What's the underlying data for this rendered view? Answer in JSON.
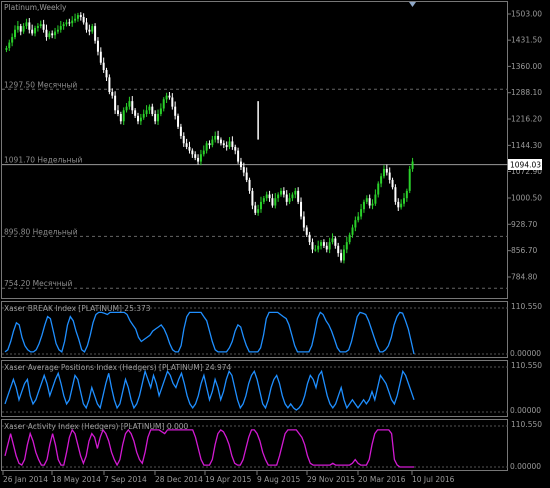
{
  "chart_title": "Platinum,Weekly",
  "price_axis": [
    "1503.00",
    "1431.50",
    "1360.00",
    "1288.10",
    "1216.20",
    "1144.30",
    "1072.90",
    "1000.50",
    "928.70",
    "856.70",
    "784.80"
  ],
  "current_price": "1094.03",
  "levels": [
    {
      "price": 1297.5,
      "label": "1297.50",
      "name": "Месячный",
      "style": "dash"
    },
    {
      "price": 1091.7,
      "label": "1091.70",
      "name": "Недельный",
      "style": "solid"
    },
    {
      "price": 895.8,
      "label": "895.80",
      "name": "Недельный",
      "style": "dash"
    },
    {
      "price": 754.2,
      "label": "754.20",
      "name": "Месячный",
      "style": "dash"
    }
  ],
  "indicators": [
    {
      "title": "Xaser BREAK Index [PLATINUM] 25.373",
      "top": "110.550",
      "bottom": "0.00000",
      "color": "#1f8fff"
    },
    {
      "title": "Xaser Average Positions Index (Hedgers) [PLATINUM] 24.974",
      "top": "110.550",
      "bottom": "0.00000",
      "color": "#1f8fff"
    },
    {
      "title": "Xaser Activity Index (Hedgers) [PLATINUM] 0.000",
      "top": "110.550",
      "bottom": "0.00000",
      "color": "#d21ad2"
    }
  ],
  "time_axis": [
    "26 Jan 2014",
    "18 May 2014",
    "7 Sep 2014",
    "28 Dec 2014",
    "19 Apr 2015",
    "9 Aug 2015",
    "29 Nov 2015",
    "20 Mar 2016",
    "10 Jul 2016"
  ],
  "colors": {
    "bull": "#2ad12a",
    "bear": "#ffffff",
    "grid": "#3a3a3a",
    "text": "#8c8c8c",
    "axis": "#9a9a9a"
  },
  "chart_data": [
    {
      "type": "candlestick",
      "title": "Platinum,Weekly",
      "ylim": [
        748,
        1530
      ],
      "series": [
        {
          "values": [
            1410,
            1425,
            1440,
            1460,
            1470,
            1455,
            1470,
            1480,
            1460,
            1450,
            1465,
            1470,
            1475,
            1460,
            1440,
            1450,
            1445,
            1455,
            1460,
            1470,
            1475,
            1480,
            1478,
            1485,
            1490,
            1500,
            1495,
            1480,
            1460,
            1455,
            1470,
            1430,
            1400,
            1370,
            1350,
            1330,
            1290,
            1280,
            1240,
            1230,
            1210,
            1240,
            1250,
            1265,
            1240,
            1225,
            1210,
            1220,
            1230,
            1240,
            1250,
            1230,
            1210,
            1230,
            1245,
            1270,
            1280,
            1275,
            1250,
            1225,
            1195,
            1170,
            1150,
            1140,
            1130,
            1120,
            1110,
            1100,
            1120,
            1130,
            1150,
            1145,
            1160,
            1170,
            1160,
            1150,
            1145,
            1140,
            1155,
            1140,
            1130,
            1100,
            1085,
            1070,
            1050,
            1020,
            980,
            960,
            970,
            990,
            1000,
            1010,
            1000,
            980,
            1000,
            1010,
            1020,
            1010,
            990,
            1000,
            1010,
            1020,
            990,
            950,
            920,
            900,
            880,
            860,
            860,
            870,
            880,
            870,
            860,
            880,
            890,
            870,
            850,
            830,
            860,
            880,
            900,
            920,
            940,
            950,
            970,
            990,
            1000,
            980,
            985,
            1010,
            1040,
            1060,
            1080,
            1070,
            1050,
            1030,
            990,
            975,
            985,
            1000,
            1020,
            1080,
            1100
          ]
        }
      ],
      "levels": [
        1297.5,
        1091.7,
        895.8,
        754.2
      ]
    },
    {
      "type": "line",
      "title": "Xaser BREAK Index [PLATINUM] 25.373",
      "ylim": [
        0,
        110.55
      ],
      "series": [
        {
          "values": [
            5,
            10,
            30,
            55,
            75,
            70,
            40,
            20,
            10,
            5,
            5,
            10,
            25,
            45,
            70,
            90,
            85,
            55,
            25,
            10,
            5,
            30,
            70,
            90,
            80,
            55,
            35,
            10,
            5,
            20,
            45,
            75,
            95,
            100,
            100,
            98,
            95,
            100,
            100,
            100,
            100,
            100,
            100,
            95,
            80,
            70,
            60,
            40,
            30,
            35,
            40,
            45,
            55,
            60,
            65,
            70,
            60,
            45,
            25,
            10,
            5,
            5,
            20,
            60,
            90,
            100,
            100,
            100,
            100,
            100,
            90,
            80,
            55,
            30,
            10,
            5,
            5,
            5,
            5,
            15,
            30,
            55,
            70,
            65,
            40,
            20,
            5,
            5,
            5,
            5,
            15,
            45,
            85,
            100,
            100,
            100,
            100,
            95,
            90,
            85,
            70,
            45,
            20,
            5,
            5,
            5,
            5,
            5,
            20,
            50,
            85,
            100,
            95,
            80,
            70,
            55,
            35,
            15,
            5,
            5,
            5,
            10,
            30,
            60,
            90,
            100,
            98,
            95,
            80,
            60,
            40,
            20,
            5,
            5,
            10,
            20,
            40,
            70,
            90,
            100,
            98,
            80,
            60,
            30,
            0
          ]
        }
      ]
    },
    {
      "type": "line",
      "title": "Xaser Average Positions Index (Hedgers) [PLATINUM] 24.974",
      "ylim": [
        0,
        110.55
      ],
      "series": [
        {
          "values": [
            20,
            40,
            60,
            80,
            60,
            30,
            50,
            70,
            80,
            40,
            20,
            30,
            50,
            70,
            90,
            70,
            40,
            60,
            80,
            95,
            70,
            40,
            20,
            30,
            60,
            90,
            80,
            50,
            20,
            10,
            30,
            60,
            40,
            20,
            10,
            40,
            70,
            95,
            60,
            30,
            10,
            20,
            50,
            80,
            60,
            30,
            10,
            20,
            40,
            70,
            100,
            80,
            60,
            90,
            70,
            40,
            60,
            80,
            100,
            90,
            70,
            60,
            80,
            95,
            70,
            40,
            20,
            10,
            20,
            40,
            70,
            90,
            60,
            30,
            50,
            80,
            60,
            30,
            50,
            80,
            100,
            90,
            60,
            30,
            10,
            20,
            40,
            70,
            90,
            100,
            80,
            50,
            20,
            10,
            30,
            60,
            80,
            90,
            70,
            40,
            20,
            10,
            20,
            10,
            5,
            10,
            20,
            40,
            70,
            90,
            80,
            60,
            90,
            100,
            70,
            40,
            20,
            10,
            20,
            40,
            60,
            30,
            10,
            20,
            30,
            20,
            10,
            20,
            30,
            20,
            30,
            50,
            30,
            60,
            90,
            80,
            70,
            50,
            30,
            20,
            40,
            70,
            100,
            90,
            70,
            50,
            30
          ]
        }
      ]
    },
    {
      "type": "line",
      "title": "Xaser Activity Index (Hedgers) [PLATINUM] 0.000",
      "ylim": [
        0,
        110.55
      ],
      "series": [
        {
          "values": [
            30,
            60,
            90,
            60,
            30,
            10,
            5,
            20,
            60,
            90,
            70,
            40,
            20,
            5,
            5,
            20,
            60,
            90,
            60,
            20,
            5,
            5,
            40,
            80,
            100,
            90,
            60,
            30,
            10,
            30,
            70,
            90,
            80,
            50,
            80,
            100,
            90,
            70,
            40,
            20,
            5,
            20,
            60,
            90,
            100,
            90,
            70,
            40,
            20,
            10,
            40,
            80,
            100,
            100,
            100,
            100,
            95,
            90,
            100,
            100,
            100,
            100,
            100,
            100,
            100,
            100,
            100,
            100,
            80,
            50,
            20,
            5,
            5,
            5,
            20,
            60,
            90,
            100,
            95,
            80,
            60,
            30,
            10,
            5,
            5,
            20,
            50,
            80,
            100,
            100,
            90,
            70,
            40,
            20,
            5,
            5,
            5,
            5,
            30,
            60,
            90,
            100,
            100,
            100,
            100,
            90,
            80,
            60,
            30,
            10,
            5,
            5,
            5,
            5,
            5,
            5,
            5,
            10,
            5,
            5,
            5,
            5,
            5,
            5,
            10,
            20,
            10,
            5,
            5,
            5,
            20,
            60,
            90,
            100,
            100,
            100,
            100,
            100,
            90,
            20,
            5,
            0,
            0,
            0,
            0,
            0,
            0
          ]
        }
      ]
    }
  ]
}
